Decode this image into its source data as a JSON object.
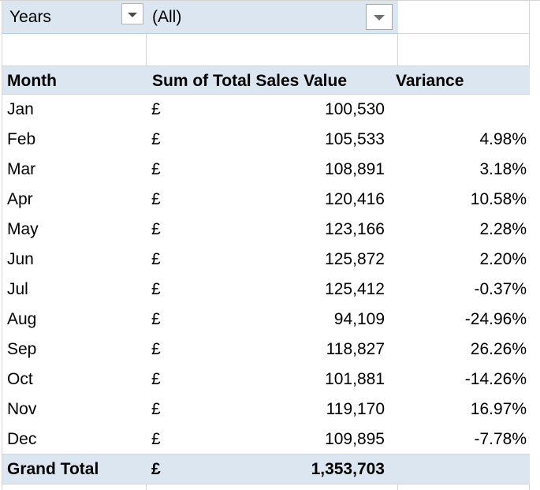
{
  "filter": {
    "label": "Years",
    "value": "(All)",
    "dropdown_icon": "chevron-down-icon"
  },
  "headers": {
    "month": "Month",
    "sum": "Sum of Total Sales Value",
    "variance": "Variance",
    "dropdown_icon": "chevron-down-icon"
  },
  "currency_symbol": "£",
  "rows": [
    {
      "month": "Jan",
      "currency": "£",
      "value": "100,530",
      "variance": ""
    },
    {
      "month": "Feb",
      "currency": "£",
      "value": "105,533",
      "variance": "4.98%"
    },
    {
      "month": "Mar",
      "currency": "£",
      "value": "108,891",
      "variance": "3.18%"
    },
    {
      "month": "Apr",
      "currency": "£",
      "value": "120,416",
      "variance": "10.58%"
    },
    {
      "month": "May",
      "currency": "£",
      "value": "123,166",
      "variance": "2.28%"
    },
    {
      "month": "Jun",
      "currency": "£",
      "value": "125,872",
      "variance": "2.20%"
    },
    {
      "month": "Jul",
      "currency": "£",
      "value": "125,412",
      "variance": "-0.37%"
    },
    {
      "month": "Aug",
      "currency": "£",
      "value": "94,109",
      "variance": "-24.96%"
    },
    {
      "month": "Sep",
      "currency": "£",
      "value": "118,827",
      "variance": "26.26%"
    },
    {
      "month": "Oct",
      "currency": "£",
      "value": "101,881",
      "variance": "-14.26%"
    },
    {
      "month": "Nov",
      "currency": "£",
      "value": "119,170",
      "variance": "16.97%"
    },
    {
      "month": "Dec",
      "currency": "£",
      "value": "109,895",
      "variance": "-7.78%"
    }
  ],
  "total": {
    "month": "Grand Total",
    "currency": "£",
    "value": "1,353,703",
    "variance": ""
  },
  "colors": {
    "header_fill": "#dce6f1",
    "gridline": "#d4d4d4",
    "text": "#000000"
  }
}
